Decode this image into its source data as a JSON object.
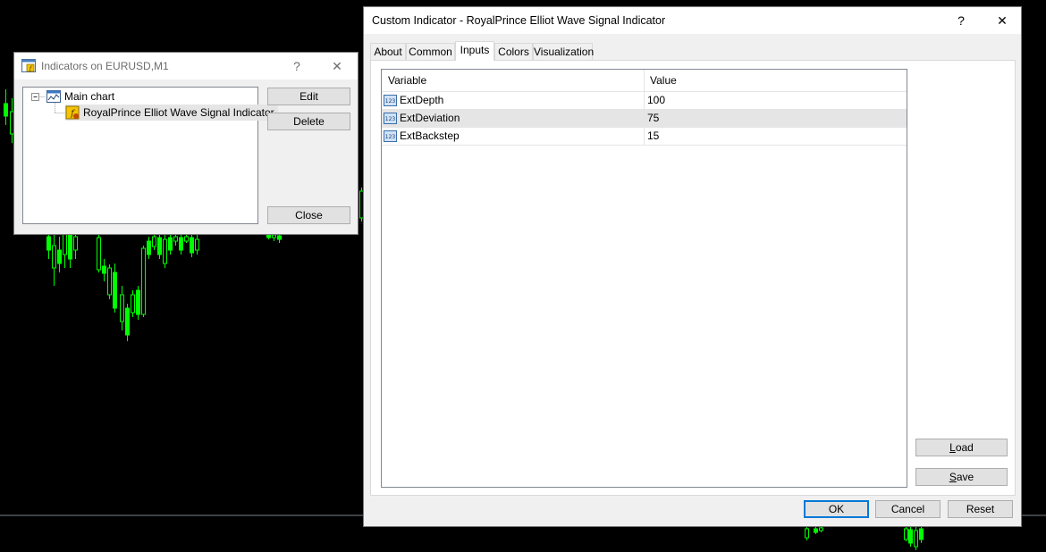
{
  "indicators_window": {
    "title": "Indicators on EURUSD,M1",
    "help_glyph": "?",
    "close_glyph": "✕",
    "tree": {
      "root_label": "Main chart",
      "expander": "−",
      "child_label": "RoyalPrince Elliot Wave Signal Indicator"
    },
    "buttons": {
      "edit": "Edit",
      "delete": "Delete",
      "close": "Close"
    }
  },
  "custom_indicator_window": {
    "title": "Custom Indicator - RoyalPrince Elliot Wave Signal Indicator",
    "help_glyph": "?",
    "close_glyph": "✕",
    "tabs": [
      "About",
      "Common",
      "Inputs",
      "Colors",
      "Visualization"
    ],
    "active_tab": "Inputs",
    "inputs_table": {
      "columns": [
        "Variable",
        "Value"
      ],
      "icon_text": "123",
      "rows": [
        {
          "variable": "ExtDepth",
          "value": "100"
        },
        {
          "variable": "ExtDeviation",
          "value": "75"
        },
        {
          "variable": "ExtBackstep",
          "value": "15"
        }
      ]
    },
    "buttons": {
      "load_first": "L",
      "load_rest": "oad",
      "save_first": "S",
      "save_rest": "ave",
      "ok": "OK",
      "cancel": "Cancel",
      "reset": "Reset"
    }
  },
  "colors": {
    "chart_bg": "#000000",
    "candle": "#00ff00",
    "selection": "#e5e5e5",
    "accent": "#0078d7"
  }
}
